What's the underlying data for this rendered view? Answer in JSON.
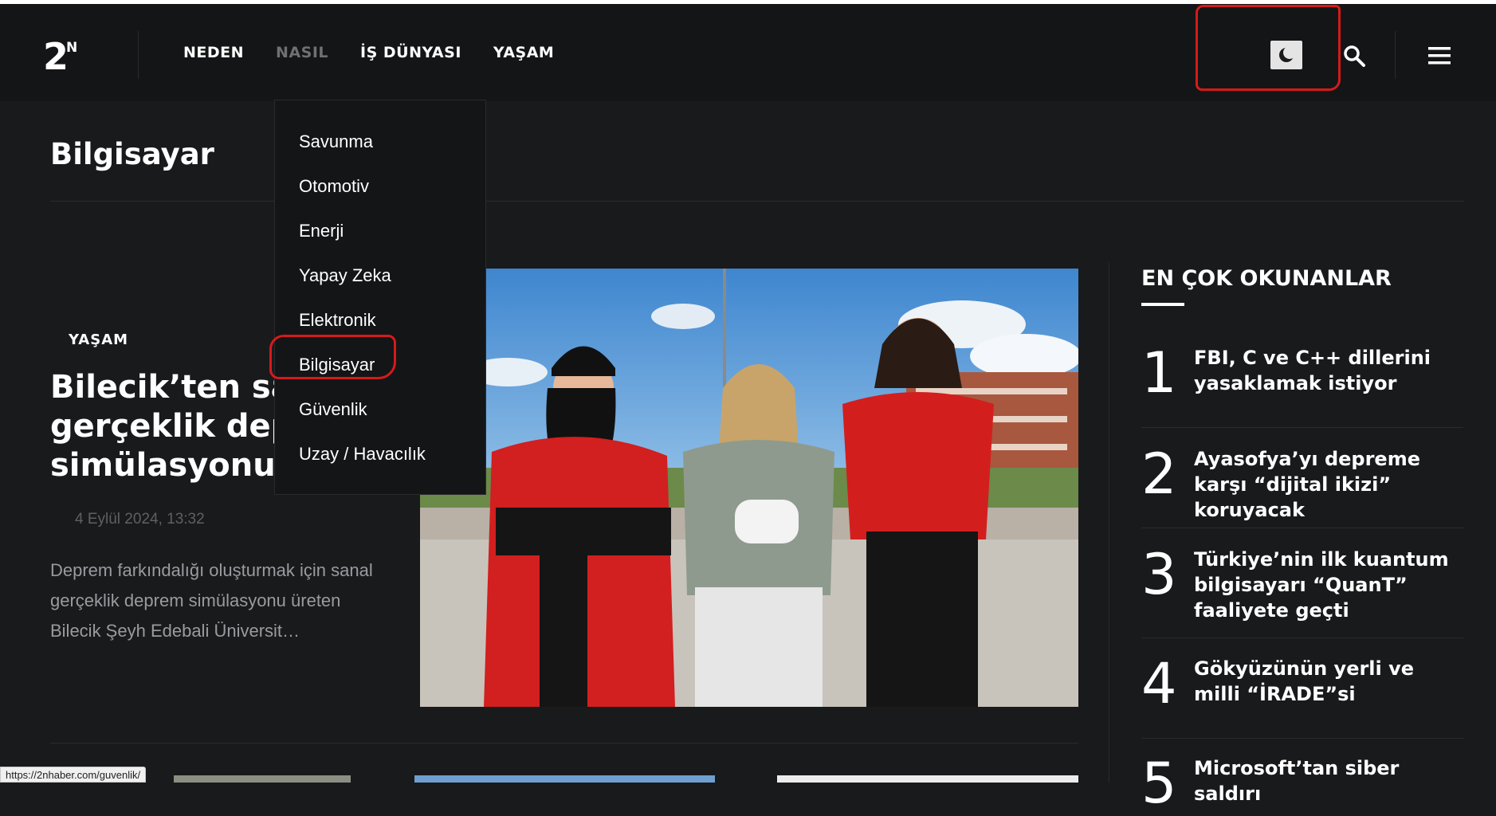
{
  "header": {
    "logo_text": "2N",
    "nav": [
      {
        "label": "NEDEN"
      },
      {
        "label": "NASIL"
      },
      {
        "label": "İŞ DÜNYASI"
      },
      {
        "label": "YAŞAM"
      }
    ]
  },
  "dropdown": {
    "items": [
      "Savunma",
      "Otomotiv",
      "Enerji",
      "Yapay Zeka",
      "Elektronik",
      "Bilgisayar",
      "Güvenlik",
      "Uzay / Havacılık"
    ]
  },
  "page": {
    "title": "Bilgisayar"
  },
  "featured": {
    "category": "YAŞAM",
    "title": "Bilecik’ten sanal gerçeklik deprem simülasyonu",
    "date": "4 Eylül 2024, 13:32",
    "excerpt": "Deprem farkındalığı oluşturmak için sanal gerçeklik deprem simülasyonu üreten Bilecik Şeyh Edebali Üniversit…"
  },
  "sidebar": {
    "title": "EN ÇOK OKUNANLAR",
    "items": [
      {
        "num": "1",
        "title": "FBI, C ve C++ dillerini yasaklamak istiyor"
      },
      {
        "num": "2",
        "title": "Ayasofya’yı depreme karşı “dijital ikizi” koruyacak"
      },
      {
        "num": "3",
        "title": "Türkiye’nin ilk kuantum bilgisayarı “QuanT” faaliyete geçti"
      },
      {
        "num": "4",
        "title": "Gökyüzünün yerli ve milli “İRADE”si"
      },
      {
        "num": "5",
        "title": "Microsoft’tan siber saldırı"
      }
    ]
  },
  "status_bar": {
    "url": "https://2nhaber.com/guvenlik/"
  },
  "colors": {
    "background": "#191a1c",
    "header": "#141517",
    "annotation": "#d61a1a",
    "muted_nav": "#6f7074"
  }
}
